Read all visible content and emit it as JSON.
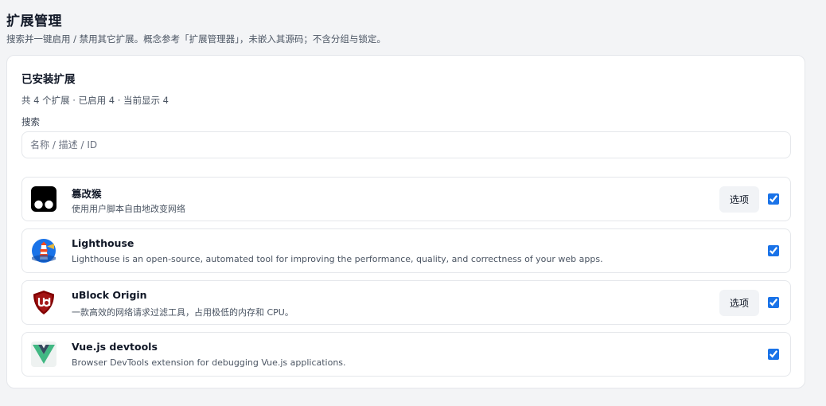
{
  "header": {
    "title": "扩展管理",
    "subtitle": "搜索并一键启用 / 禁用其它扩展。概念参考「扩展管理器」，未嵌入其源码；不含分组与锁定。"
  },
  "panel": {
    "title": "已安装扩展",
    "stats": "共 4 个扩展 · 已启用 4 · 当前显示 4",
    "search": {
      "label": "搜索",
      "placeholder": "名称 / 描述 / ID",
      "value": ""
    }
  },
  "extensions": [
    {
      "name": "篡改猴",
      "description": "使用用户脚本自由地改变网络",
      "icon": "tampermonkey-icon",
      "options_label": "选项",
      "enabled": true
    },
    {
      "name": "Lighthouse",
      "description": "Lighthouse is an open-source, automated tool for improving the performance, quality, and correctness of your web apps.",
      "icon": "lighthouse-icon",
      "enabled": true
    },
    {
      "name": "uBlock Origin",
      "description": "一款高效的网络请求过滤工具，占用极低的内存和 CPU。",
      "icon": "ublock-origin-icon",
      "options_label": "选项",
      "enabled": true
    },
    {
      "name": "Vue.js devtools",
      "description": "Browser DevTools extension for debugging Vue.js applications.",
      "icon": "vue-devtools-icon",
      "enabled": true
    }
  ],
  "colors": {
    "page_background": "#f3f4f6",
    "checkbox_accent": "#1a73e8",
    "options_button_bg": "#f1f3f6"
  }
}
